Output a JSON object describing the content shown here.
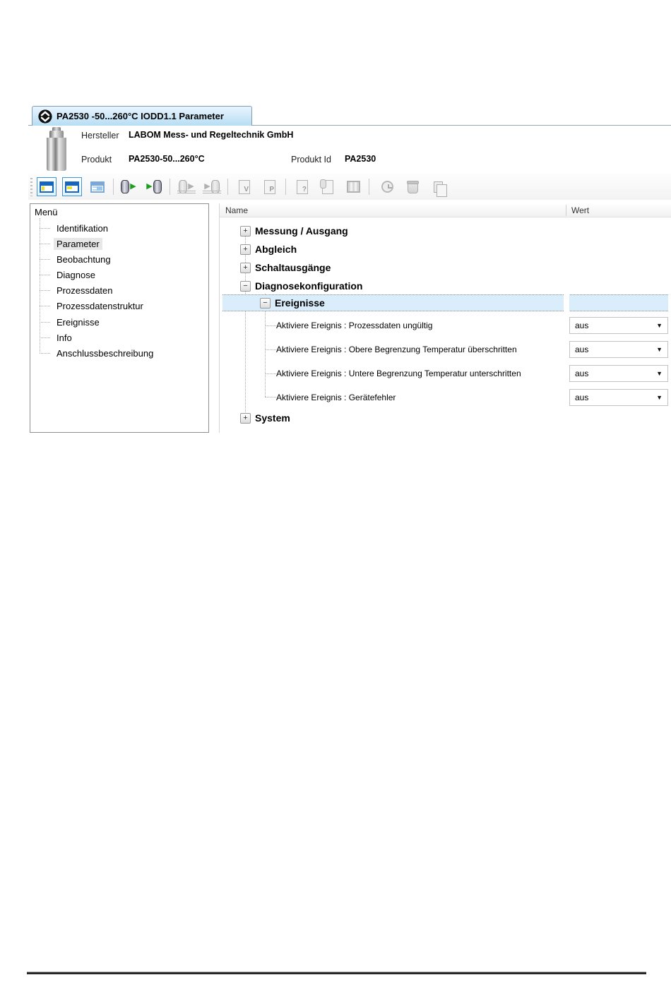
{
  "tab": {
    "title": "PA2530 -50...260°C IODD1.1 Parameter",
    "icon": "iodd-logo-icon"
  },
  "header": {
    "hersteller_label": "Hersteller",
    "hersteller_value": "LABOM Mess- und Regeltechnik GmbH",
    "produkt_label": "Produkt",
    "produkt_value": "PA2530-50...260°C",
    "produkt_id_label": "Produkt Id",
    "produkt_id_value": "PA2530"
  },
  "toolbar": {
    "buttons": [
      {
        "icon": "topology-view-icon",
        "active": true,
        "enabled": true
      },
      {
        "icon": "device-view-icon",
        "active": true,
        "enabled": true
      },
      {
        "icon": "grid-view-icon",
        "active": false,
        "enabled": true
      },
      {
        "icon": "read-from-device-icon",
        "enabled": true
      },
      {
        "icon": "write-to-device-icon",
        "enabled": true
      },
      {
        "icon": "upload-from-device-icon",
        "enabled": false
      },
      {
        "icon": "download-to-device-icon",
        "enabled": false
      },
      {
        "icon": "vendor-document-icon",
        "enabled": false,
        "letter": "V"
      },
      {
        "icon": "product-document-icon",
        "enabled": false,
        "letter": "P"
      },
      {
        "icon": "device-help-icon",
        "enabled": false,
        "letter": "?"
      },
      {
        "icon": "device-sync-icon",
        "enabled": false,
        "letter": ""
      },
      {
        "icon": "data-table-icon",
        "enabled": false
      },
      {
        "icon": "history-icon",
        "enabled": false
      },
      {
        "icon": "delete-icon",
        "enabled": false
      },
      {
        "icon": "save-icon",
        "enabled": false
      }
    ]
  },
  "menu": {
    "root": "Menü",
    "items": [
      {
        "label": "Identifikation",
        "selected": false
      },
      {
        "label": "Parameter",
        "selected": true
      },
      {
        "label": "Beobachtung",
        "selected": false
      },
      {
        "label": "Diagnose",
        "selected": false
      },
      {
        "label": "Prozessdaten",
        "selected": false
      },
      {
        "label": "Prozessdatenstruktur",
        "selected": false
      },
      {
        "label": "Ereignisse",
        "selected": false
      },
      {
        "label": "Info",
        "selected": false
      },
      {
        "label": "Anschlussbeschreibung",
        "selected": false
      }
    ]
  },
  "params": {
    "columns": {
      "name": "Name",
      "wert": "Wert"
    },
    "rows": [
      {
        "label": "Messung / Ausgang",
        "expander": "+",
        "level": 1
      },
      {
        "label": "Abgleich",
        "expander": "+",
        "level": 1
      },
      {
        "label": "Schaltausgänge",
        "expander": "+",
        "level": 1
      },
      {
        "label": "Diagnosekonfiguration",
        "expander": "−",
        "level": 1
      },
      {
        "label": "Ereignisse",
        "expander": "−",
        "level": 2,
        "selected": true
      },
      {
        "label": "Aktiviere Ereignis : Prozessdaten ungültig",
        "value": "aus",
        "level": 3
      },
      {
        "label": "Aktiviere Ereignis : Obere Begrenzung Temperatur überschritten",
        "value": "aus",
        "level": 3
      },
      {
        "label": "Aktiviere Ereignis : Untere Begrenzung Temperatur unterschritten",
        "value": "aus",
        "level": 3
      },
      {
        "label": "Aktiviere Ereignis : Gerätefehler",
        "value": "aus",
        "level": 3
      },
      {
        "label": "System",
        "expander": "+",
        "level": 1
      }
    ]
  }
}
